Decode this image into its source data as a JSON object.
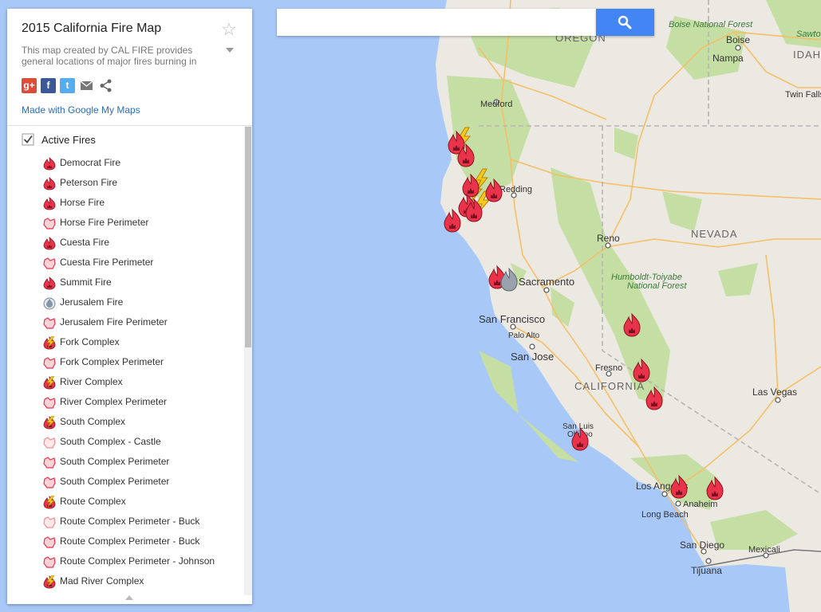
{
  "header": {
    "title": "2015 California Fire Map",
    "description": "This map created by CAL FIRE provides general locations of major fires burning in",
    "made_with": "Made with Google My Maps"
  },
  "share": [
    {
      "name": "google-plus",
      "glyph": "g+",
      "color": "#dd4b39"
    },
    {
      "name": "facebook",
      "glyph": "f",
      "color": "#3b5998"
    },
    {
      "name": "twitter",
      "glyph": "t",
      "color": "#55acee"
    },
    {
      "name": "email",
      "glyph": "",
      "color": "#777777"
    },
    {
      "name": "share",
      "glyph": "",
      "color": "#777777"
    }
  ],
  "layer": {
    "name": "Active Fires",
    "checked": true,
    "items": [
      {
        "label": "Democrat Fire",
        "icon": "fire-icon"
      },
      {
        "label": "Peterson Fire",
        "icon": "fire-icon"
      },
      {
        "label": "Horse Fire",
        "icon": "fire-icon"
      },
      {
        "label": "Horse Fire Perimeter",
        "icon": "perimeter-icon"
      },
      {
        "label": "Cuesta Fire",
        "icon": "fire-icon"
      },
      {
        "label": "Cuesta Fire Perimeter",
        "icon": "perimeter-icon"
      },
      {
        "label": "Summit Fire",
        "icon": "fire-icon"
      },
      {
        "label": "Jerusalem Fire",
        "icon": "contained-fire-icon"
      },
      {
        "label": "Jerusalem Fire Perimeter",
        "icon": "perimeter-icon"
      },
      {
        "label": "Fork Complex",
        "icon": "lightning-fire-icon"
      },
      {
        "label": "Fork Complex Perimeter",
        "icon": "perimeter-icon"
      },
      {
        "label": "River Complex",
        "icon": "lightning-fire-icon"
      },
      {
        "label": "River Complex Perimeter",
        "icon": "perimeter-icon"
      },
      {
        "label": "South Complex",
        "icon": "lightning-fire-icon"
      },
      {
        "label": "South Complex - Castle",
        "icon": "perimeter-light-icon"
      },
      {
        "label": "South Complex Perimeter",
        "icon": "perimeter-icon"
      },
      {
        "label": "South Complex Perimeter",
        "icon": "perimeter-icon"
      },
      {
        "label": "Route Complex",
        "icon": "lightning-fire-icon"
      },
      {
        "label": "Route Complex Perimeter - Buck",
        "icon": "perimeter-light-icon"
      },
      {
        "label": "Route Complex Perimeter - Buck",
        "icon": "perimeter-icon"
      },
      {
        "label": "Route Complex Perimeter - Johnson",
        "icon": "perimeter-icon"
      },
      {
        "label": "Mad River Complex",
        "icon": "lightning-fire-icon"
      }
    ]
  },
  "search": {
    "placeholder": ""
  },
  "map": {
    "labels": {
      "oregon": "OREGON",
      "idaho": "IDAHO",
      "nevada": "NEVADA",
      "california": "CALIFORNIA",
      "boise_nf": "Boise National Forest",
      "boise": "Boise",
      "sawtooth": "Sawto",
      "nampa": "Nampa",
      "twin_falls": "Twin Falls",
      "medford": "Medford",
      "redding": "Redding",
      "reno": "Reno",
      "humboldt_1": "Humboldt-Toiyabe",
      "humboldt_2": "National Forest",
      "sacramento": "Sacramento",
      "san_francisco": "San Francisco",
      "palo_alto_1": "Palo",
      "palo_alto_2": "Alto",
      "san_jose": "San Jose",
      "fresno": "Fresno",
      "las_vegas": "Las Vegas",
      "san_luis_1": "San Luis",
      "san_luis_2": "Obispo",
      "los_angeles": "Los Angeles",
      "anaheim": "Anaheim",
      "long_beach": "Long Beach",
      "san_diego": "San Diego",
      "mexicali": "Mexicali",
      "tijuana": "Tijuana"
    },
    "colors": {
      "ocean": "#a8c8f8",
      "land": "#ece9e2",
      "forest": "#c4dea4",
      "road": "#f5bf67",
      "border": "#b5b5b5",
      "fire": "#e8334a",
      "lightning": "#f7c81e"
    }
  }
}
